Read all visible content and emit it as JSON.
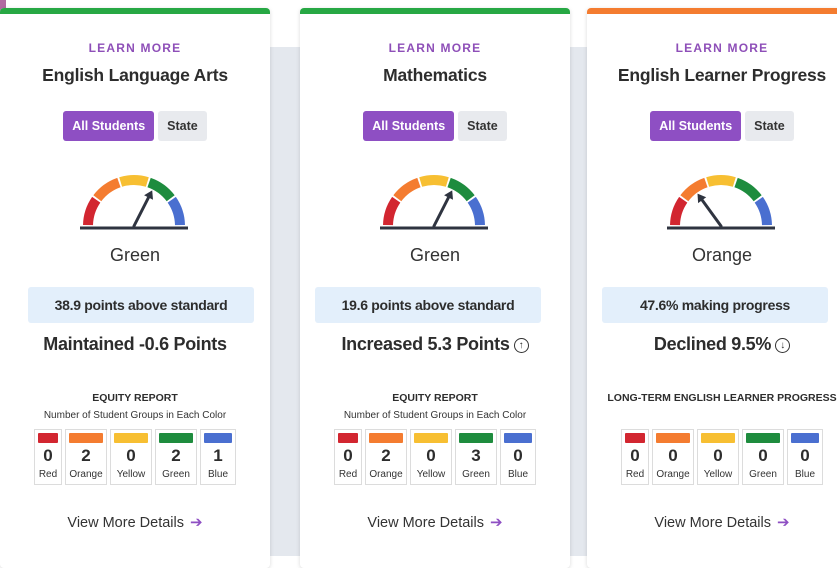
{
  "cards": [
    {
      "topbar_color": "#27a844",
      "learn_more": "LEARN MORE",
      "title": "English Language Arts",
      "toggle": {
        "active": "All Students",
        "inactive": "State"
      },
      "gauge": {
        "needle": "green",
        "icon": "gauge-icon"
      },
      "rating": "Green",
      "status": "38.9 points above standard",
      "change": "Maintained -0.6 Points",
      "change_icon": "",
      "equity_title": "EQUITY REPORT",
      "equity_subtitle": "Number of Student Groups in Each Color",
      "groups": [
        {
          "count": "0",
          "name": "Red",
          "color": "#d22630"
        },
        {
          "count": "2",
          "name": "Orange",
          "color": "#f47c30"
        },
        {
          "count": "0",
          "name": "Yellow",
          "color": "#f7bf32"
        },
        {
          "count": "2",
          "name": "Green",
          "color": "#1e8c3e"
        },
        {
          "count": "1",
          "name": "Blue",
          "color": "#4a6fd0"
        }
      ],
      "view_more": "View More Details"
    },
    {
      "topbar_color": "#27a844",
      "learn_more": "LEARN MORE",
      "title": "Mathematics",
      "toggle": {
        "active": "All Students",
        "inactive": "State"
      },
      "gauge": {
        "needle": "green",
        "icon": "gauge-icon"
      },
      "rating": "Green",
      "status": "19.6 points above standard",
      "change": "Increased 5.3 Points",
      "change_icon": "arrow-up-circle-icon",
      "equity_title": "EQUITY REPORT",
      "equity_subtitle": "Number of Student Groups in Each Color",
      "groups": [
        {
          "count": "0",
          "name": "Red",
          "color": "#d22630"
        },
        {
          "count": "2",
          "name": "Orange",
          "color": "#f47c30"
        },
        {
          "count": "0",
          "name": "Yellow",
          "color": "#f7bf32"
        },
        {
          "count": "3",
          "name": "Green",
          "color": "#1e8c3e"
        },
        {
          "count": "0",
          "name": "Blue",
          "color": "#4a6fd0"
        }
      ],
      "view_more": "View More Details"
    },
    {
      "topbar_color": "#f47c30",
      "learn_more": "LEARN MORE",
      "title": "English Learner Progress",
      "toggle": {
        "active": "All Students",
        "inactive": "State"
      },
      "gauge": {
        "needle": "orange",
        "icon": "gauge-icon"
      },
      "rating": "Orange",
      "status": "47.6% making progress",
      "change": "Declined 9.5%",
      "change_icon": "arrow-down-circle-icon",
      "equity_title": "LONG-TERM ENGLISH LEARNER PROGRESS",
      "equity_subtitle": "",
      "groups": [
        {
          "count": "0",
          "name": "Red",
          "color": "#d22630"
        },
        {
          "count": "0",
          "name": "Orange",
          "color": "#f47c30"
        },
        {
          "count": "0",
          "name": "Yellow",
          "color": "#f7bf32"
        },
        {
          "count": "0",
          "name": "Green",
          "color": "#1e8c3e"
        },
        {
          "count": "0",
          "name": "Blue",
          "color": "#4a6fd0"
        }
      ],
      "view_more": "View More Details"
    }
  ]
}
